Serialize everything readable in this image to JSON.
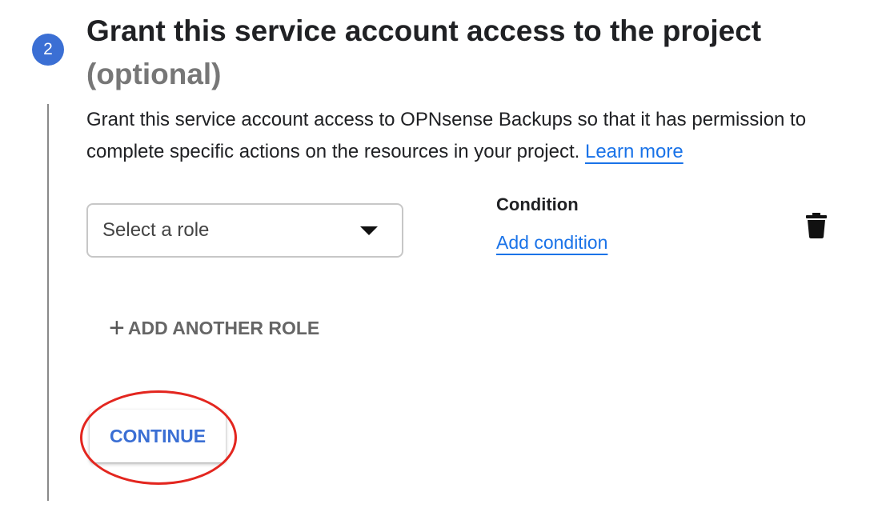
{
  "step": {
    "number": "2",
    "title": "Grant this service account access to the project",
    "optional": "(optional)"
  },
  "description": {
    "text": "Grant this service account access to OPNsense Backups so that it has permission to complete specific actions on the resources in your project. ",
    "learn_more": "Learn more"
  },
  "role": {
    "placeholder": "Select a role"
  },
  "condition": {
    "label": "Condition",
    "add_link": "Add condition"
  },
  "actions": {
    "add_role": "ADD ANOTHER ROLE",
    "continue": "CONTINUE"
  },
  "icons": {
    "delete": "trash-icon",
    "dropdown": "caret-down-icon",
    "add": "plus-icon"
  },
  "colors": {
    "accent": "#3b6fd4",
    "link": "#1a73e8",
    "highlight": "#e3261f"
  }
}
